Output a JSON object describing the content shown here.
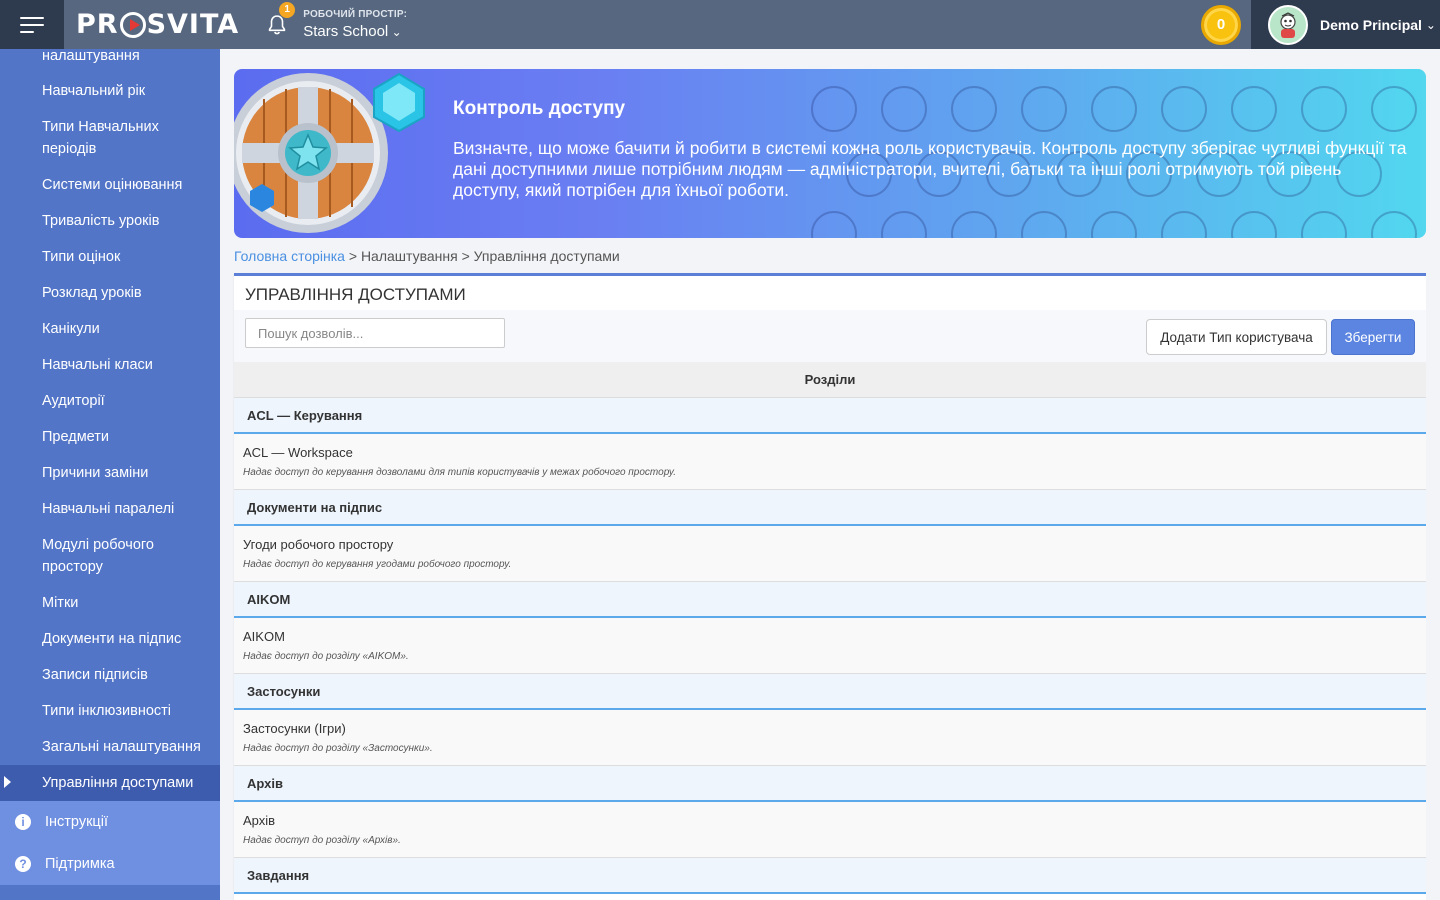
{
  "header": {
    "logo_text_left": "PR",
    "logo_text_right": "SVITA",
    "notification_count": "1",
    "workspace_label": "РОБОЧИЙ ПРОСТІР:",
    "workspace_name": "Stars School",
    "coins": "0",
    "user_name": "Demo Principal"
  },
  "sidebar": {
    "items": [
      {
        "label": "налаштування"
      },
      {
        "label": "Навчальний рік"
      },
      {
        "label": "Типи Навчальних періодів"
      },
      {
        "label": "Системи оцінювання"
      },
      {
        "label": "Тривалість уроків"
      },
      {
        "label": "Типи оцінок"
      },
      {
        "label": "Розклад уроків"
      },
      {
        "label": "Канікули"
      },
      {
        "label": "Навчальні класи"
      },
      {
        "label": "Аудиторії"
      },
      {
        "label": "Предмети"
      },
      {
        "label": "Причини заміни"
      },
      {
        "label": "Навчальні паралелі"
      },
      {
        "label": "Модулі робочого простору"
      },
      {
        "label": "Мітки"
      },
      {
        "label": "Документи на підпис"
      },
      {
        "label": "Записи підписів"
      },
      {
        "label": "Типи інклюзивності"
      },
      {
        "label": "Загальні налаштування"
      },
      {
        "label": "Управління доступами"
      }
    ],
    "bottom": [
      {
        "label": "Інструкції",
        "icon": "info-icon"
      },
      {
        "label": "Підтримка",
        "icon": "help-icon"
      }
    ]
  },
  "banner": {
    "title": "Контроль доступу",
    "text": "Визначте, що може бачити й робити в системі кожна роль користувачів. Контроль доступу зберігає чутливі функції та дані доступними лише потрібним людям — адміністратори, вчителі, батьки та інші ролі отримують той рівень доступу, який потрібен для їхньої роботи."
  },
  "breadcrumb": {
    "home": "Головна сторінка",
    "sep": ">",
    "settings": "Налаштування",
    "current": "Управління доступами"
  },
  "panel": {
    "title": "УПРАВЛІННЯ ДОСТУПАМИ",
    "search_placeholder": "Пошук дозволів...",
    "add_button": "Додати Тип користувача",
    "save_button": "Зберегти",
    "column_header": "Розділи",
    "sections": [
      {
        "title": "ACL — Керування",
        "perms": [
          {
            "name": "ACL — Workspace",
            "desc": "Надає доступ до керування дозволами для типів користувачів у межах робочого простору."
          }
        ]
      },
      {
        "title": "Документи на підпис",
        "perms": [
          {
            "name": "Угоди робочого простору",
            "desc": "Надає доступ до керування угодами робочого простору."
          }
        ]
      },
      {
        "title": "AIKOM",
        "perms": [
          {
            "name": "AIKOM",
            "desc": "Надає доступ до розділу «AIKOM»."
          }
        ]
      },
      {
        "title": "Застосунки",
        "perms": [
          {
            "name": "Застосунки (Ігри)",
            "desc": "Надає доступ до розділу «Застосунки»."
          }
        ]
      },
      {
        "title": "Архів",
        "perms": [
          {
            "name": "Архів",
            "desc": "Надає доступ до розділу «Архів»."
          }
        ]
      },
      {
        "title": "Завдання",
        "perms": []
      }
    ]
  },
  "colors": {
    "topbar": "#56677f",
    "sidebar": "#5275c7",
    "sidebar_active": "#3d5cae",
    "accent": "#5b85e0",
    "section_border": "#5ba8ea"
  }
}
